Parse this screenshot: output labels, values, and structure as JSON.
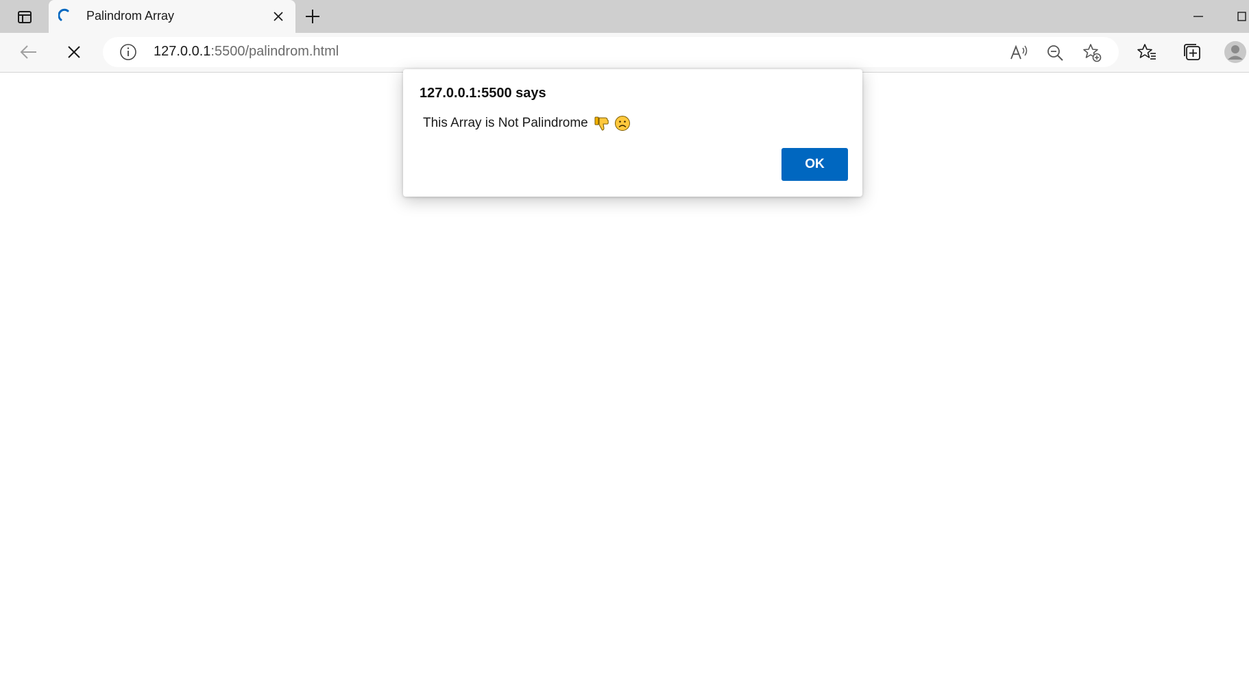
{
  "browser": {
    "tab": {
      "title": "Palindrom Array"
    },
    "address": {
      "url_host": "127.0.0.1",
      "url_rest": ":5500/palindrom.html"
    }
  },
  "dialog": {
    "title": "127.0.0.1:5500 says",
    "message": "This Array is Not Palindrome",
    "message_emojis": [
      "thumbs-down-icon",
      "frowning-face-icon"
    ],
    "ok_label": "OK"
  },
  "colors": {
    "ok_button": "#0067c0",
    "tabstrip": "#cfcfcf",
    "toolbar": "#f7f7f7"
  }
}
